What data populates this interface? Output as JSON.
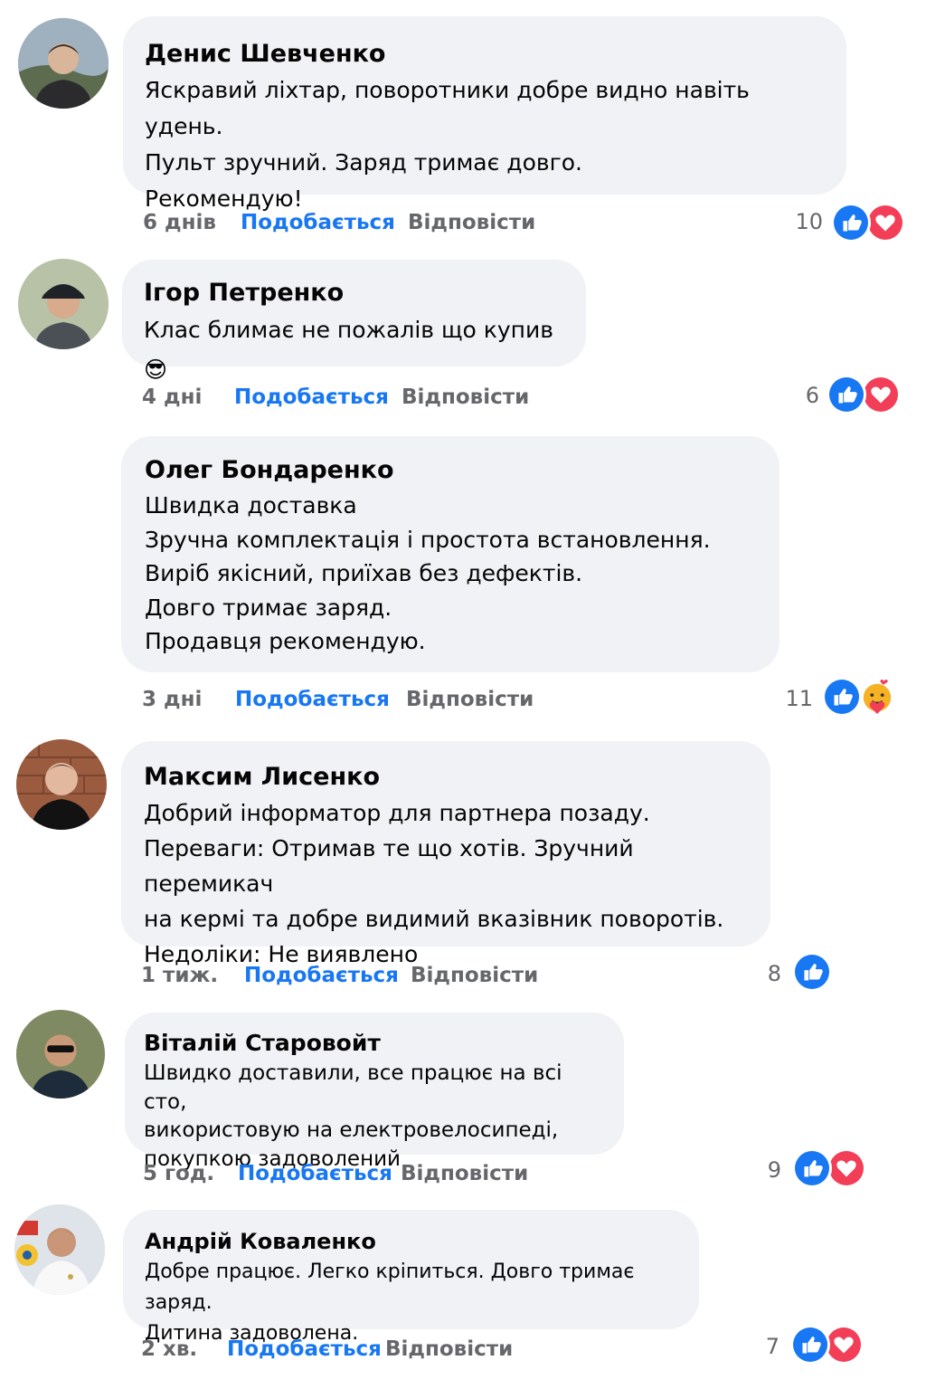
{
  "actions": {
    "like": "Подобається",
    "reply": "Відповісти"
  },
  "colors": {
    "like_blue": "#1877f2",
    "love_red": "#f33e58",
    "bubble": "#f0f2f5",
    "meta_gray": "#65676b"
  },
  "comments": [
    {
      "author": "Денис Шевченко",
      "lines": [
        "Яскравий ліхтар, поворотники добре видно навіть удень.",
        "Пульт зручний. Заряд тримає довго.",
        "Рекомендую!"
      ],
      "time": "6 днів",
      "count": "10",
      "reactions": [
        "like-icon",
        "love-icon"
      ]
    },
    {
      "author": "Ігор Петренко",
      "lines": [
        "Клас блимає не пожалів що купив 😎"
      ],
      "time": "4 дні",
      "count": "6",
      "reactions": [
        "like-icon",
        "love-icon"
      ]
    },
    {
      "author": "Олег Бондаренко",
      "lines": [
        "Швидка доставка",
        "Зручна комплектація і простота встановлення.",
        "Виріб якісний, приїхав без дефектів.",
        "Довго тримає заряд.",
        "Продавця рекомендую."
      ],
      "time": "3 дні",
      "count": "11",
      "reactions": [
        "like-icon",
        "care-icon"
      ]
    },
    {
      "author": "Максим Лисенко",
      "lines": [
        "Добрий інформатор для партнера позаду.",
        "Переваги: Отримав те що хотів. Зручний перемикач",
        "на кермі та добре видимий вказівник поворотів.",
        "Недоліки: Не виявлено"
      ],
      "time": "1 тиж.",
      "count": "8",
      "reactions": [
        "like-icon"
      ]
    },
    {
      "author": "Віталій Старовойт",
      "lines": [
        "Швидко доставили, все працює на всі сто,",
        "використовую на електровелосипеді,",
        "покупкою задоволений"
      ],
      "time": "5 год.",
      "count": "9",
      "reactions": [
        "like-icon",
        "love-icon"
      ]
    },
    {
      "author": "Андрій Коваленко",
      "lines": [
        "Добре працює. Легко кріпиться. Довго тримає заряд.",
        "Дитина задоволена."
      ],
      "time": "2 хв.",
      "count": "7",
      "reactions": [
        "like-icon",
        "love-icon"
      ]
    }
  ]
}
